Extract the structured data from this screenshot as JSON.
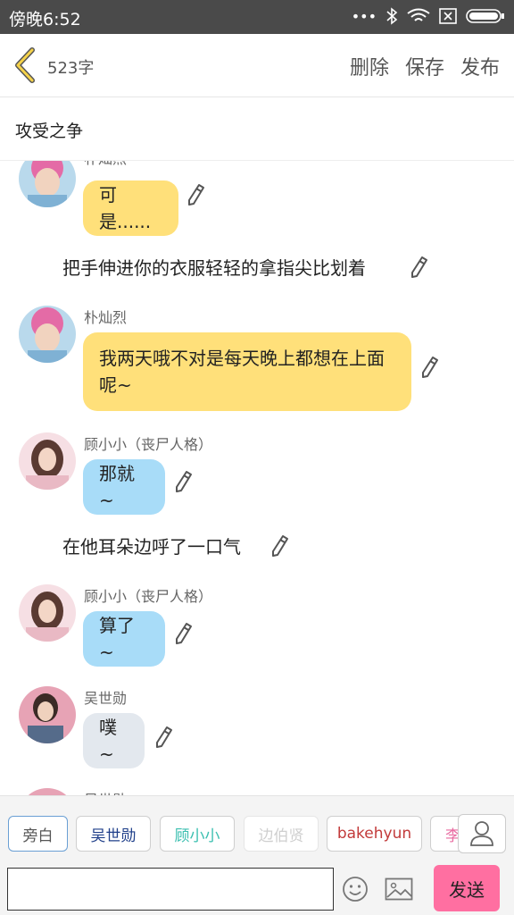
{
  "status_bar": {
    "time": "傍晚6:52"
  },
  "header": {
    "word_count": "523字",
    "delete_label": "删除",
    "save_label": "保存",
    "publish_label": "发布"
  },
  "story": {
    "title": "攻受之争"
  },
  "messages": [
    {
      "speaker": "朴灿烈",
      "text": "可是......"
    },
    {
      "narration": "把手伸进你的衣服轻轻的拿指尖比划着"
    },
    {
      "speaker": "朴灿烈",
      "text": "我两天哦不对是每天晚上都想在上面呢~"
    },
    {
      "speaker": "顾小小（丧尸人格）",
      "text": "那就~"
    },
    {
      "narration": "在他耳朵边呼了一口气"
    },
    {
      "speaker": "顾小小（丧尸人格）",
      "text": "算了~"
    },
    {
      "speaker": "吴世勋",
      "text": "噗~"
    },
    {
      "speaker": "吴世勋"
    }
  ],
  "characters": [
    "旁白",
    "吴世勋",
    "顾小小",
    "边伯贤",
    "bakehyun",
    "李"
  ],
  "composer": {
    "placeholder": "",
    "send_label": "发送"
  },
  "colors": {
    "yellow_bubble": "#ffe07a",
    "blue_bubble": "#a8dcf8",
    "grey_bubble": "#e3e8ee",
    "send_button": "#ff6fa1"
  }
}
